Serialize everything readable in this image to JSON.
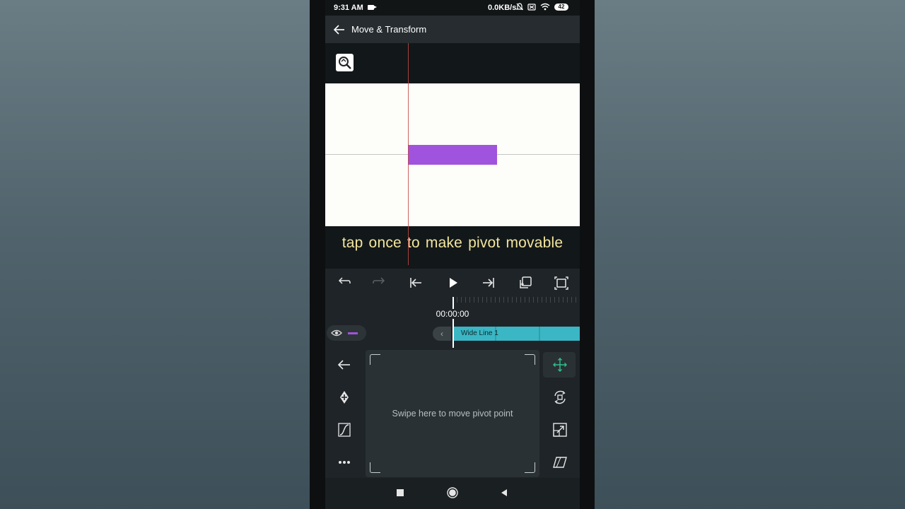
{
  "status_bar": {
    "time": "9:31 AM",
    "network_speed": "0.0KB/s",
    "battery": "42",
    "icons": [
      "video-recording-icon",
      "mute-icon",
      "no-sim-icon",
      "wifi-icon",
      "battery-icon"
    ]
  },
  "app_bar": {
    "title": "Move & Transform",
    "back_icon": "arrow-left-icon"
  },
  "preview": {
    "zoom_icon": "zoom-icon",
    "layer_color": "#a053dc",
    "canvas_bg": "#fdfdf9"
  },
  "caption": "tap once  to make pivot movable",
  "controls": [
    "undo-icon",
    "redo-icon",
    "skip-to-start-icon",
    "play-icon",
    "skip-to-end-icon",
    "duplicate-icon",
    "fullscreen-icon"
  ],
  "timeline": {
    "timecode": "00:00:00",
    "clip_label": "Wide Line 1",
    "clip_color": "#3bb6c4"
  },
  "tools_left": [
    "back-arrow-icon",
    "keyframe-icon",
    "easing-curve-icon",
    "more-icon"
  ],
  "tools_right": [
    "move-icon",
    "rotate-icon",
    "scale-icon",
    "skew-icon"
  ],
  "pivot_pad": {
    "hint": "Swipe here to move pivot point"
  },
  "accent_color": "#2fbf8a"
}
